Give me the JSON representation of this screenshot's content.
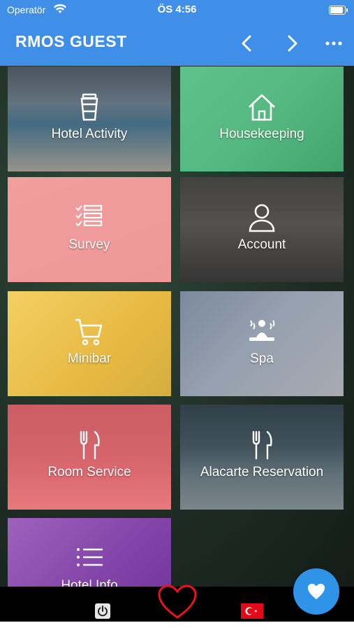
{
  "status_bar": {
    "carrier": "Operatör",
    "time": "ÖS 4:56"
  },
  "nav": {
    "title": "RMOS GUEST",
    "back_icon": "chevron-left-icon",
    "forward_icon": "chevron-right-icon",
    "more_icon": "ellipsis-icon"
  },
  "tiles": [
    {
      "label": "Hotel Activity",
      "icon": "coffee-cup-icon",
      "overlay": "#5b6570"
    },
    {
      "label": "Housekeeping",
      "icon": "house-icon",
      "overlay": "#2fb36a"
    },
    {
      "label": "Survey",
      "icon": "checklist-icon",
      "overlay": "#f08080"
    },
    {
      "label": "Account",
      "icon": "user-icon",
      "overlay": "#4a4a4a"
    },
    {
      "label": "Minibar",
      "icon": "shopping-cart-icon",
      "overlay": "#f2c744"
    },
    {
      "label": "Spa",
      "icon": "spa-icon",
      "overlay": "#7a8799"
    },
    {
      "label": "Room Service",
      "icon": "fork-knife-icon",
      "overlay": "#f06b73"
    },
    {
      "label": "Alacarte Reservation",
      "icon": "fork-knife-icon",
      "overlay": "#3a4a56"
    },
    {
      "label": "Hotel Info",
      "icon": "list-icon",
      "overlay": "#8a3fb3"
    }
  ],
  "bottom_bar": {
    "power_icon": "power-icon",
    "heart_icon": "heart-outline-icon",
    "flag": "turkey-flag-icon"
  },
  "fab": {
    "icon": "heart-icon",
    "color": "#2f93e8"
  },
  "colors": {
    "nav_blue": "#3f8ee8",
    "heart_red": "#e8141c"
  }
}
